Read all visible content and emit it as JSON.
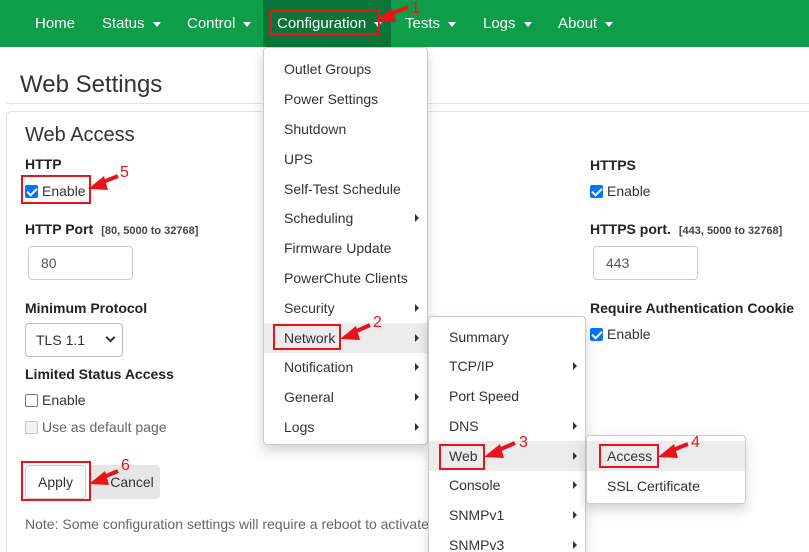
{
  "nav": {
    "items": [
      {
        "label": "Home",
        "caret": false
      },
      {
        "label": "Status",
        "caret": true
      },
      {
        "label": "Control",
        "caret": true
      },
      {
        "label": "Configuration",
        "caret": true
      },
      {
        "label": "Tests",
        "caret": true
      },
      {
        "label": "Logs",
        "caret": true
      },
      {
        "label": "About",
        "caret": true
      }
    ]
  },
  "page": {
    "title": "Web Settings",
    "section_title": "Web Access"
  },
  "form": {
    "http_label": "HTTP",
    "http_enable_label": "Enable",
    "http_enabled": true,
    "http_port_label": "HTTP Port",
    "http_port_hint": "[80, 5000 to 32768]",
    "http_port_value": "80",
    "min_protocol_label": "Minimum Protocol",
    "min_protocol_value": "TLS 1.1",
    "limited_status_label": "Limited Status Access",
    "limited_enable_label": "Enable",
    "limited_enabled": false,
    "default_page_label": "Use as default page",
    "https_label": "HTTPS",
    "https_enable_label": "Enable",
    "https_enabled": true,
    "https_port_label": "HTTPS port.",
    "https_port_hint": "[443, 5000 to 32768]",
    "https_port_value": "443",
    "auth_cookie_label": "Require Authentication Cookie",
    "auth_cookie_enable_label": "Enable",
    "auth_cookie_enabled": true,
    "apply_label": "Apply",
    "cancel_label": "Cancel",
    "note": "Note: Some configuration settings will require a reboot to activate"
  },
  "menus": {
    "configuration": [
      {
        "label": "Outlet Groups",
        "submenu": false
      },
      {
        "label": "Power Settings",
        "submenu": false
      },
      {
        "label": "Shutdown",
        "submenu": false
      },
      {
        "label": "UPS",
        "submenu": false
      },
      {
        "label": "Self-Test Schedule",
        "submenu": false
      },
      {
        "label": "Scheduling",
        "submenu": true
      },
      {
        "label": "Firmware Update",
        "submenu": false
      },
      {
        "label": "PowerChute Clients",
        "submenu": false
      },
      {
        "label": "Security",
        "submenu": true
      },
      {
        "label": "Network",
        "submenu": true
      },
      {
        "label": "Notification",
        "submenu": true
      },
      {
        "label": "General",
        "submenu": true
      },
      {
        "label": "Logs",
        "submenu": true
      }
    ],
    "network": [
      {
        "label": "Summary",
        "submenu": false
      },
      {
        "label": "TCP/IP",
        "submenu": true
      },
      {
        "label": "Port Speed",
        "submenu": false
      },
      {
        "label": "DNS",
        "submenu": true
      },
      {
        "label": "Web",
        "submenu": true
      },
      {
        "label": "Console",
        "submenu": true
      },
      {
        "label": "SNMPv1",
        "submenu": true
      },
      {
        "label": "SNMPv3",
        "submenu": true
      }
    ],
    "web": [
      {
        "label": "Access",
        "submenu": false
      },
      {
        "label": "SSL Certificate",
        "submenu": false
      }
    ]
  },
  "annotations": {
    "steps": [
      "1",
      "2",
      "3",
      "4",
      "5",
      "6"
    ],
    "color": "#e8141b"
  },
  "colors": {
    "navbar": "#0e9d48",
    "navbar_active": "#0a7537",
    "checkbox": "#0075ff"
  }
}
